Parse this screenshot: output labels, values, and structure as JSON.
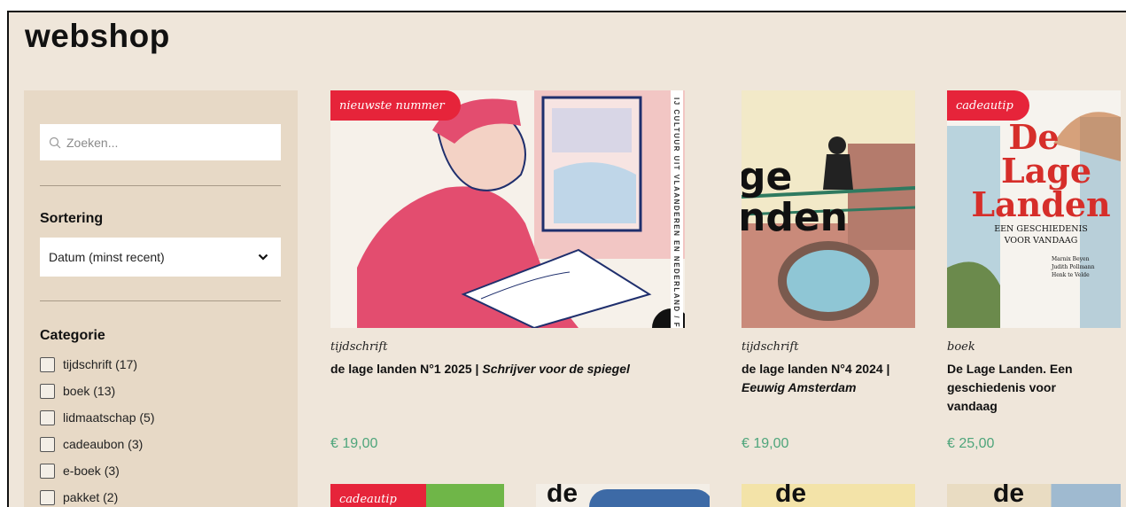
{
  "page": {
    "title": "webshop"
  },
  "sidebar": {
    "search": {
      "placeholder": "Zoeken..."
    },
    "sort": {
      "label": "Sortering",
      "selected": "Datum (minst recent)"
    },
    "category": {
      "label": "Categorie",
      "items": [
        {
          "label": "tijdschrift (17)"
        },
        {
          "label": "boek (13)"
        },
        {
          "label": "lidmaatschap (5)"
        },
        {
          "label": "cadeaubon (3)"
        },
        {
          "label": "e-boek (3)"
        },
        {
          "label": "pakket (2)"
        }
      ]
    }
  },
  "products": [
    {
      "badge": "nieuwste nummer",
      "type": "tijdschrift",
      "name_main": "de lage landen N°1 2025 | ",
      "name_italic": "Schrijver voor de spiegel",
      "price": "€ 19,00",
      "cover_text": "IJ CULTUUR UIT VLAANDEREN EN NEDERLAND / FEBRUARI"
    },
    {
      "badge": "",
      "type": "tijdschrift",
      "name_main": "de lage landen N°4 2024 |",
      "name_italic": "Eeuwig Amsterdam",
      "price": "€ 19,00",
      "cover_text": "ge nden"
    },
    {
      "badge": "cadeautip",
      "type": "boek",
      "name_main": "De Lage Landen. Een geschiedenis voor vandaag",
      "name_italic": "",
      "price": "€ 25,00",
      "cover_title": [
        "De",
        "Lage",
        "Landen"
      ],
      "cover_subtitle": [
        "EEN GESCHIEDENIS",
        "VOOR VANDAAG"
      ],
      "cover_authors": [
        "Marnix Beyen",
        "Judith Pollmann",
        "Henk te Velde"
      ]
    }
  ],
  "row2": {
    "badge": "cadeautip",
    "texts": [
      "de",
      "de",
      "de"
    ]
  },
  "colors": {
    "accent_red": "#e6243a",
    "price_green": "#4ea57b",
    "background": "#efe6da",
    "sidebar": "#e7d9c6"
  }
}
